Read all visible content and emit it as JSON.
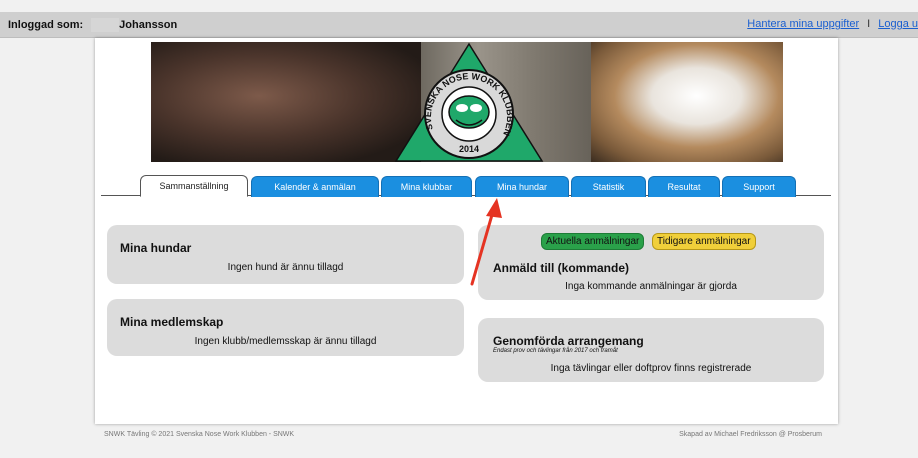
{
  "topbar": {
    "logged_in_label": "Inloggad som:",
    "username": "Johansson",
    "manage_link": "Hantera mina uppgifter",
    "separator": "I",
    "logout_link": "Logga u"
  },
  "banner": {
    "logo_text": "SVENSKA NOSE WORK KLUBBEN",
    "logo_year": "2014"
  },
  "tabs": [
    {
      "label": "Sammanställning",
      "active": true
    },
    {
      "label": "Kalender & anmälan"
    },
    {
      "label": "Mina klubbar"
    },
    {
      "label": "Mina hundar"
    },
    {
      "label": "Statistik"
    },
    {
      "label": "Resultat"
    },
    {
      "label": "Support"
    }
  ],
  "cards": {
    "dogs": {
      "title": "Mina hundar",
      "text": "Ingen hund är ännu tillagd"
    },
    "memberships": {
      "title": "Mina medlemskap",
      "text": "Ingen klubb/medlemsskap är ännu tillagd"
    },
    "registered": {
      "btn_current": "Aktuella anmälningar",
      "btn_previous": "Tidigare anmälningar",
      "title": "Anmäld till (kommande)",
      "text": "Inga kommande anmälningar är gjorda"
    },
    "completed": {
      "title": "Genomförda arrangemang",
      "subtitle": "Endast prov och tävlingar från 2017 och framåt",
      "text": "Inga tävlingar eller doftprov finns registrerade"
    }
  },
  "footer": {
    "left": "SNWK Tävling © 2021 Svenska Nose Work Klubben - SNWK",
    "right": "Skapad av Michael Fredriksson @ Prosberum"
  },
  "colors": {
    "tab_blue": "#1b8fe0",
    "btn_green": "#2aa14a",
    "btn_yellow": "#f0cf3a",
    "arrow_red": "#e53322",
    "logo_green": "#1fa86a"
  }
}
